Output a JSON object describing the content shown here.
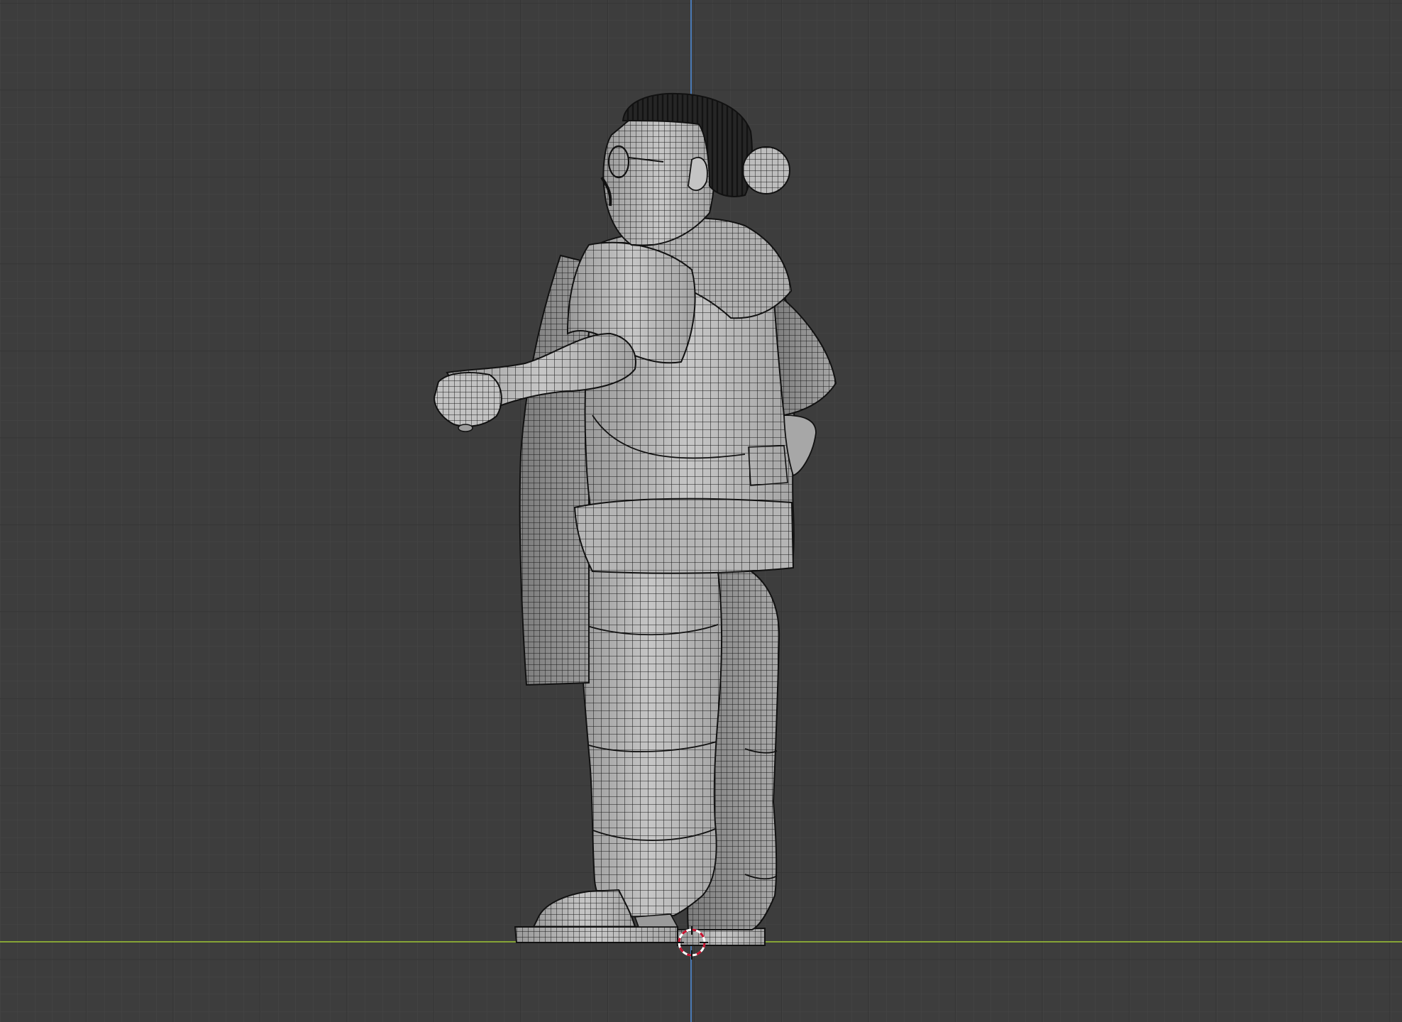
{
  "viewport": {
    "view": "side-orthographic",
    "shading": "solid-wireframe",
    "background_color": "#3d3d3d",
    "grid_minor_color": "#464646",
    "grid_major_color": "#303030",
    "x_axis_color": "#7d9a2f",
    "z_axis_color": "#3f6ea8",
    "mesh_fill_color": "#b9b9b9",
    "mesh_wire_color": "#141414",
    "hair_color": "#262626",
    "cursor_colors": [
      "#c8102e",
      "#ffffff"
    ]
  },
  "scene": {
    "objects": [
      {
        "name": "character-mesh",
        "icon": "mesh-icon"
      },
      {
        "name": "3d-cursor",
        "icon": "crosshair-icon"
      }
    ]
  }
}
